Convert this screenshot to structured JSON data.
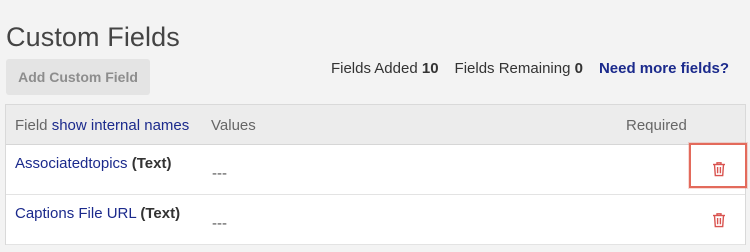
{
  "page": {
    "title": "Custom Fields"
  },
  "toolbar": {
    "add_label": "Add Custom Field",
    "fields_added_label": "Fields Added",
    "fields_added_value": "10",
    "fields_remaining_label": "Fields Remaining",
    "fields_remaining_value": "0",
    "more_fields_link": "Need more fields?"
  },
  "table": {
    "headers": {
      "field": "Field",
      "show_internal_link": "show internal names",
      "values": "Values",
      "required": "Required"
    },
    "rows": [
      {
        "name": "Associatedtopics",
        "type": "(Text)",
        "values": "---"
      },
      {
        "name": "Captions File URL",
        "type": "(Text)",
        "values": "---"
      }
    ]
  },
  "colors": {
    "link": "#1b2a8c",
    "delete_icon": "#d9534f",
    "highlight": "#e36a5b"
  }
}
